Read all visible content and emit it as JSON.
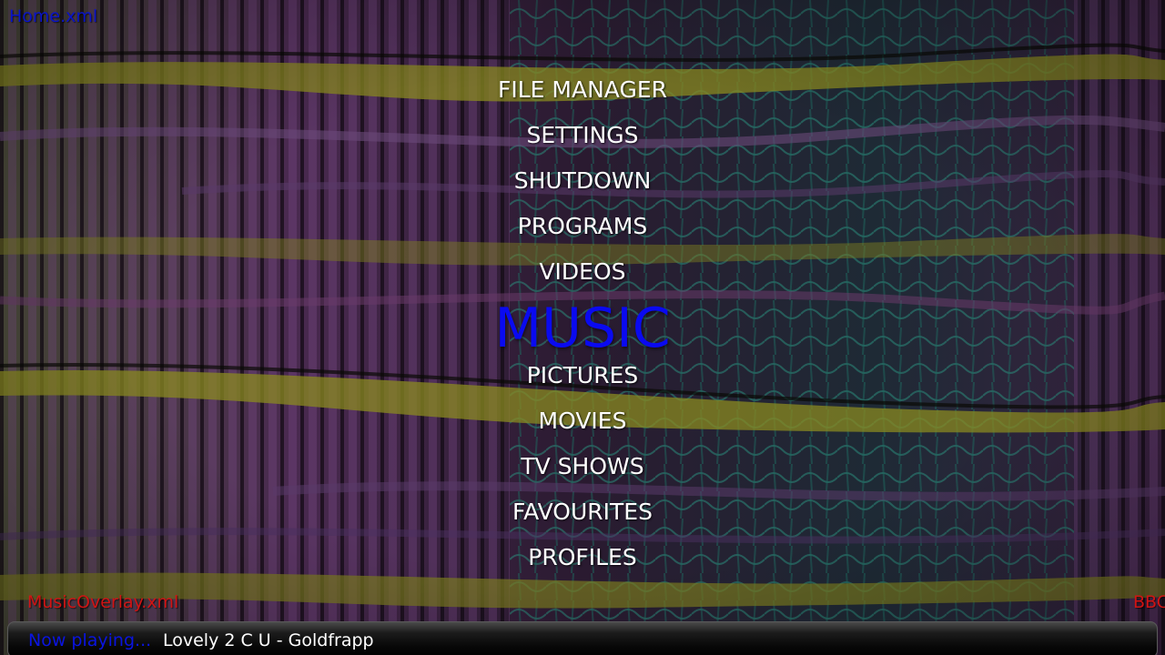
{
  "debug": {
    "window_xml": "Home.xml",
    "overlay_xml": "MusicOverlay.xml",
    "overlay_right_fragment": "BBC"
  },
  "colors": {
    "focused": "#0a0af0",
    "debug_window": "#0a14c8",
    "debug_overlay": "#d01414",
    "now_playing_prefix": "#0a14e0"
  },
  "menu": {
    "items": [
      {
        "label": "FILE MANAGER",
        "focused": false
      },
      {
        "label": "SETTINGS",
        "focused": false
      },
      {
        "label": "SHUTDOWN",
        "focused": false
      },
      {
        "label": "PROGRAMS",
        "focused": false
      },
      {
        "label": "VIDEOS",
        "focused": false
      },
      {
        "label": "MUSIC",
        "focused": true
      },
      {
        "label": "PICTURES",
        "focused": false
      },
      {
        "label": "MOVIES",
        "focused": false
      },
      {
        "label": "TV SHOWS",
        "focused": false
      },
      {
        "label": "FAVOURITES",
        "focused": false
      },
      {
        "label": "PROFILES",
        "focused": false
      }
    ]
  },
  "now_playing": {
    "prefix": "Now playing...",
    "track": "Lovely 2 C U - Goldfrapp"
  }
}
